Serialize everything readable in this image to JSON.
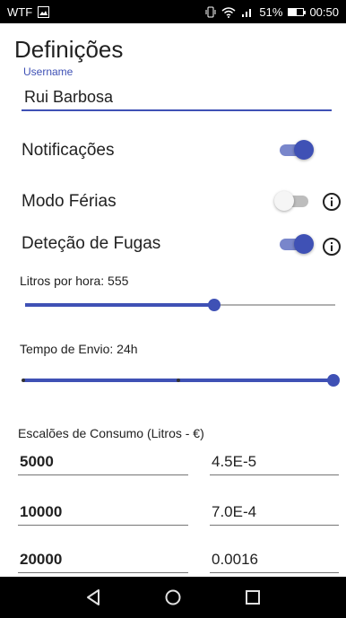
{
  "status_bar": {
    "carrier": "WTF",
    "battery": "51%",
    "battery_level": 0.51,
    "time": "00:50",
    "icons": [
      "image-icon",
      "vibrate-icon",
      "wifi-icon",
      "signal-icon",
      "battery-icon"
    ]
  },
  "page": {
    "title": "Definições"
  },
  "username": {
    "label": "Username",
    "value": "Rui Barbosa"
  },
  "toggles": [
    {
      "label": "Notificações",
      "on": true,
      "has_info": false
    },
    {
      "label": "Modo Férias",
      "on": false,
      "has_info": true
    },
    {
      "label": "Deteção de Fugas",
      "on": true,
      "has_info": true
    }
  ],
  "liters_slider": {
    "label": "Litros por hora: 555",
    "fraction": 0.61
  },
  "send_time_slider": {
    "label": "Tempo de Envio: 24h",
    "fraction": 1.0,
    "ticks": 3
  },
  "consumption": {
    "label": "Escalões de Consumo (Litros - €)",
    "tiers": [
      {
        "liters": "5000",
        "price": "4.5E-5"
      },
      {
        "liters": "10000",
        "price": "7.0E-4"
      },
      {
        "liters": "20000",
        "price": "0.0016"
      }
    ]
  },
  "nav": {
    "buttons": [
      "back-icon",
      "home-icon",
      "recents-icon"
    ]
  },
  "colors": {
    "accent": "#3f51b5",
    "accent_light": "#7986cb",
    "status_bar": "#000000"
  }
}
